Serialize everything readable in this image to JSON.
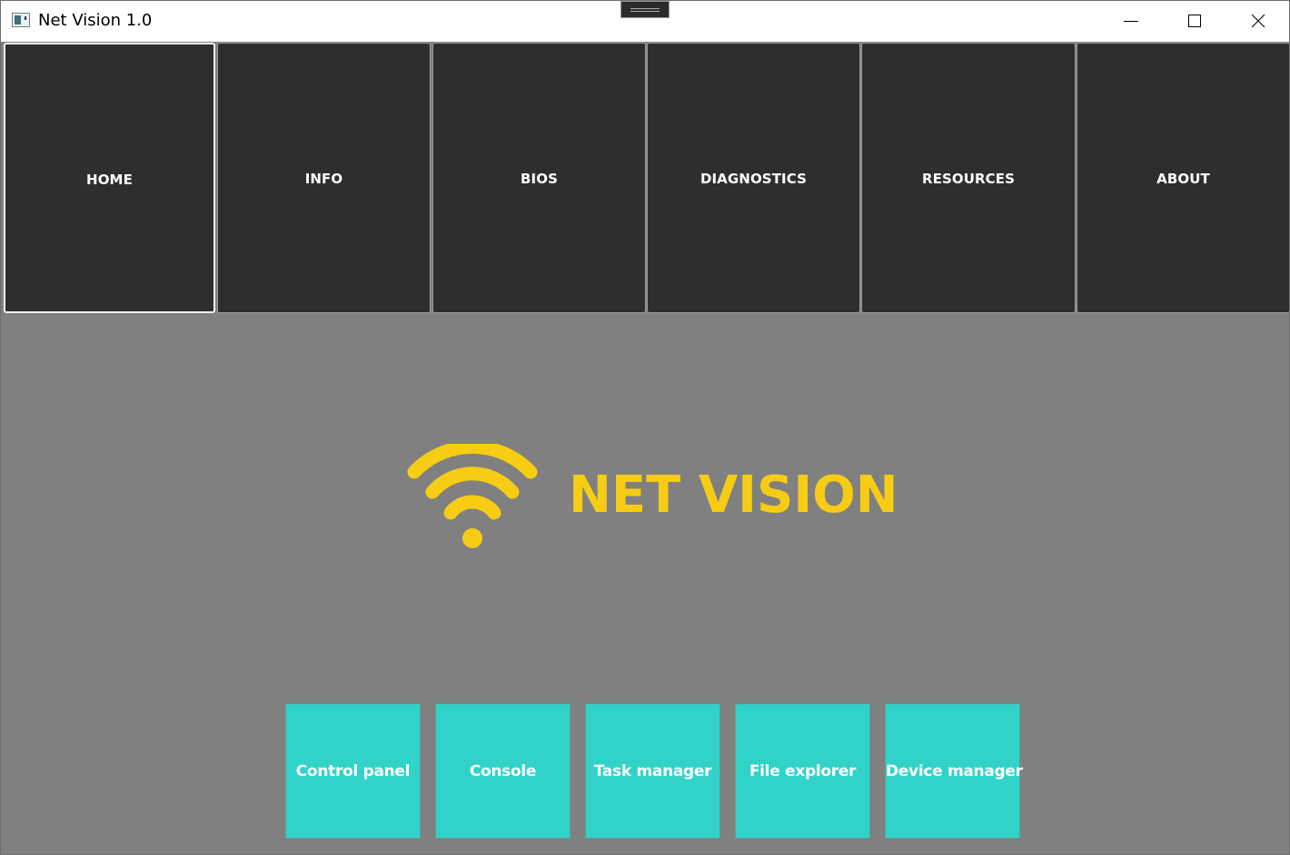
{
  "window": {
    "title": "Net Vision 1.0",
    "controls": [
      "minimize",
      "maximize",
      "close"
    ]
  },
  "nav": {
    "active": "HOME",
    "items": [
      {
        "label": "HOME"
      },
      {
        "label": "INFO"
      },
      {
        "label": "BIOS"
      },
      {
        "label": "DIAGNOSTICS"
      },
      {
        "label": "RESOURCES"
      },
      {
        "label": "ABOUT"
      }
    ]
  },
  "brand": {
    "name": "NET VISION",
    "icon": "wifi-icon",
    "color": "#f6cd14"
  },
  "tools": [
    {
      "label": "Control panel"
    },
    {
      "label": "Console"
    },
    {
      "label": "Task manager"
    },
    {
      "label": "File explorer"
    },
    {
      "label": "Device manager"
    }
  ],
  "colors": {
    "background": "#808080",
    "nav_tile": "#2e2e2e",
    "tool_tile": "#31d3c8"
  }
}
